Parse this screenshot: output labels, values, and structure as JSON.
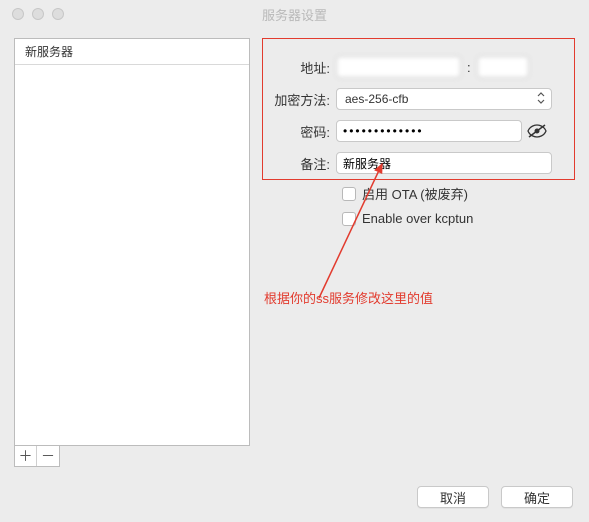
{
  "window": {
    "title": "服务器设置"
  },
  "sidebar": {
    "header": "新服务器"
  },
  "form": {
    "address": {
      "label": "地址:",
      "value": "",
      "port": ""
    },
    "encryption": {
      "label": "加密方法:",
      "value": "aes-256-cfb"
    },
    "password": {
      "label": "密码:",
      "value": "•••••••••••••"
    },
    "remark": {
      "label": "备注:",
      "value": "新服务器"
    },
    "ota": {
      "label": "启用 OTA (被废弃)"
    },
    "kcptun": {
      "label": "Enable over kcptun"
    }
  },
  "annotation": {
    "text": "根据你的ss服务修改这里的值"
  },
  "buttons": {
    "cancel": "取消",
    "ok": "确定",
    "add": "＋",
    "remove": "－"
  }
}
